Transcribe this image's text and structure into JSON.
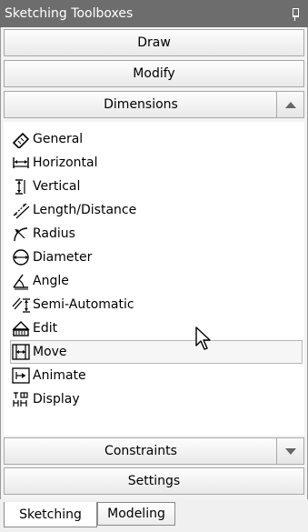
{
  "title": "Sketching Toolboxes",
  "sections": {
    "draw": "Draw",
    "modify": "Modify",
    "dimensions": "Dimensions",
    "constraints": "Constraints",
    "settings": "Settings"
  },
  "dimension_tools": [
    {
      "label": "General",
      "icon": "general-dimension-icon"
    },
    {
      "label": "Horizontal",
      "icon": "horizontal-dimension-icon"
    },
    {
      "label": "Vertical",
      "icon": "vertical-dimension-icon"
    },
    {
      "label": "Length/Distance",
      "icon": "length-distance-icon"
    },
    {
      "label": "Radius",
      "icon": "radius-icon"
    },
    {
      "label": "Diameter",
      "icon": "diameter-icon"
    },
    {
      "label": "Angle",
      "icon": "angle-icon"
    },
    {
      "label": "Semi-Automatic",
      "icon": "semi-automatic-icon"
    },
    {
      "label": "Edit",
      "icon": "edit-icon"
    },
    {
      "label": "Move",
      "icon": "move-icon"
    },
    {
      "label": "Animate",
      "icon": "animate-icon"
    },
    {
      "label": "Display",
      "icon": "display-icon"
    }
  ],
  "selected_tool": "Move",
  "tabs": [
    {
      "label": "Sketching",
      "active": true
    },
    {
      "label": "Modeling",
      "active": false
    }
  ]
}
